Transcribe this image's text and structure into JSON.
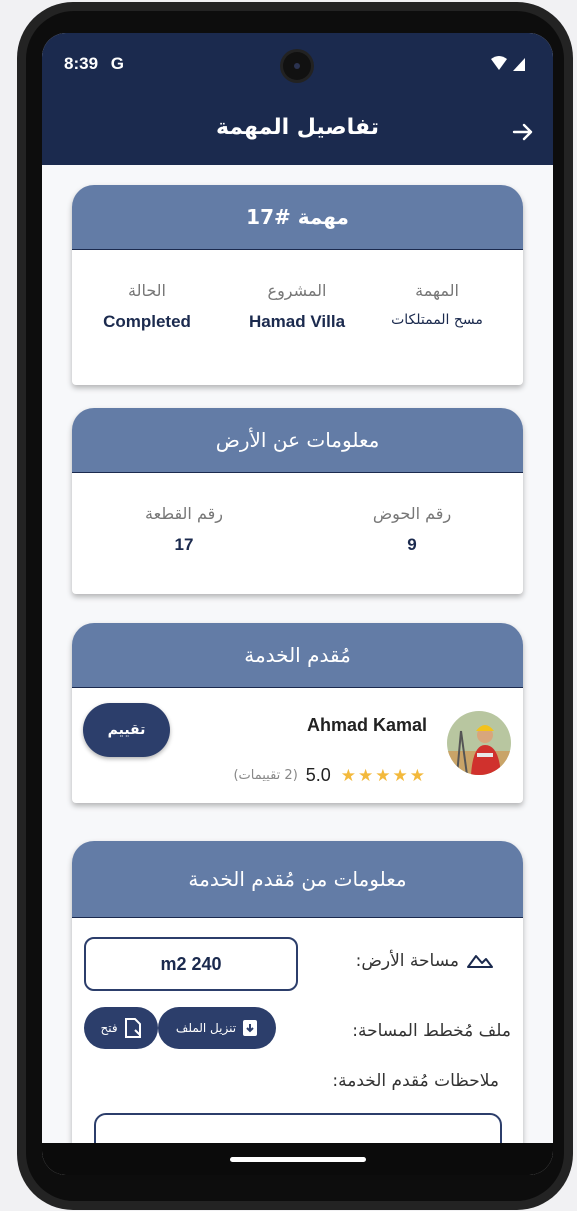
{
  "status_bar": {
    "time": "8:39",
    "g_icon": "google-g-icon",
    "wifi_icon": "wifi-icon",
    "signal_icon": "signal-icon"
  },
  "app_bar": {
    "title": "تفاصيل المهمة",
    "back_icon": "arrow-right-icon"
  },
  "task_card": {
    "header": "مهمة #17",
    "columns": [
      {
        "label": "المهمة",
        "value": "مسح الممتلكات"
      },
      {
        "label": "المشروع",
        "value": "Hamad Villa"
      },
      {
        "label": "الحالة",
        "value": "Completed"
      }
    ]
  },
  "land_card": {
    "header": "معلومات عن الأرض",
    "columns": [
      {
        "label": "رقم الحوض",
        "value": "9"
      },
      {
        "label": "رقم القطعة",
        "value": "17"
      }
    ]
  },
  "provider_card": {
    "header": "مُقدم الخدمة",
    "name": "Ahmad Kamal",
    "score": "5.0",
    "stars_filled": 5,
    "stars_max": 5,
    "rating_count": "(2 تقييمات)",
    "rate_button": "تقييم"
  },
  "provider_info_card": {
    "header": "معلومات من مُقدم الخدمة",
    "area_label": "مساحة الأرض:",
    "area_value": "m2 240",
    "plan_label": "ملف مُخطط المساحة:",
    "download_label": "تنزيل الملف",
    "open_label": "فتح",
    "notes_label": "ملاحظات مُقدم الخدمة:"
  },
  "colors": {
    "dark_navy": "#1b2a4e",
    "card_header": "#637ca6",
    "button": "#2c3e6b",
    "star": "#f3b93c"
  }
}
